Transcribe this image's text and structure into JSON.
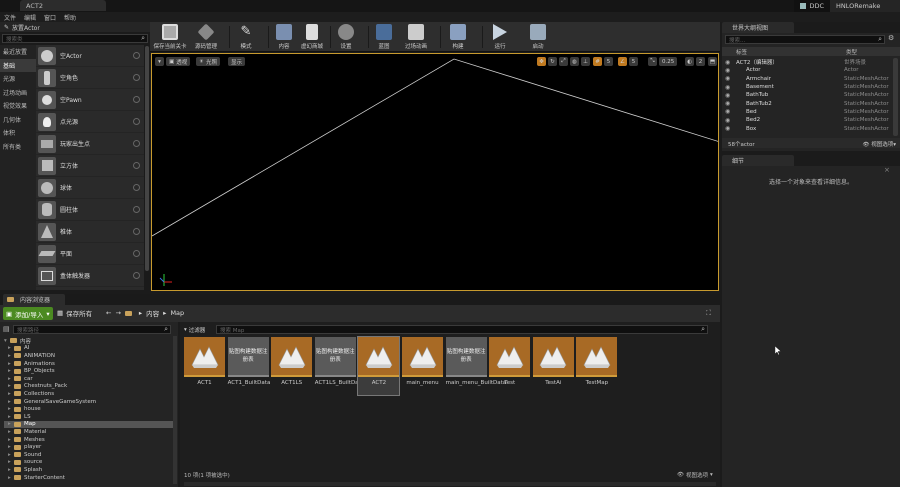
{
  "window": {
    "tab_title": "ACT2",
    "right_label": "DDC",
    "project_name": "HNLORemake"
  },
  "menu": [
    "文件",
    "编辑",
    "窗口",
    "帮助"
  ],
  "toolbar": [
    {
      "label": "保存当前关卡",
      "icon": "save-icon"
    },
    {
      "label": "源码管理",
      "icon": "source-control-icon"
    },
    {
      "label": "模式",
      "icon": "modes-icon"
    },
    {
      "label": "内容",
      "icon": "content-icon"
    },
    {
      "label": "虚幻商城",
      "icon": "marketplace-icon"
    },
    {
      "label": "设置",
      "icon": "settings-icon"
    },
    {
      "label": "蓝图",
      "icon": "blueprints-icon"
    },
    {
      "label": "过场动画",
      "icon": "cinematics-icon"
    },
    {
      "label": "构建",
      "icon": "build-icon"
    },
    {
      "label": "运行",
      "icon": "play-icon"
    },
    {
      "label": "启动",
      "icon": "launch-icon"
    }
  ],
  "modes": {
    "tab_label": "放置Actor",
    "search_placeholder": "搜索类",
    "categories": [
      "最近放置",
      "基础",
      "光源",
      "过场动画",
      "视觉效果",
      "几何体",
      "体积",
      "所有类"
    ],
    "active_category": 1,
    "items": [
      "空Actor",
      "空角色",
      "空Pawn",
      "点光源",
      "玩家出生点",
      "立方体",
      "球体",
      "圆柱体",
      "椎体",
      "平面",
      "盒体触发器"
    ]
  },
  "viewport": {
    "perspective_label": "透视",
    "lit_label": "光照",
    "show_label": "显示",
    "grid_snap": "5",
    "rot_snap": "5",
    "scale_snap": "0.25",
    "camera_speed": "2"
  },
  "outliner": {
    "tab_label": "世界大纲视图",
    "search_placeholder": "搜索...",
    "col_label": "标签",
    "col_type": "类型",
    "rows": [
      {
        "name": "ACT2（编辑器）",
        "type": "世界场景",
        "indent": 0
      },
      {
        "name": "Actor",
        "type": "Actor",
        "indent": 1
      },
      {
        "name": "Armchair",
        "type": "StaticMeshActor",
        "indent": 1
      },
      {
        "name": "Basement",
        "type": "StaticMeshActor",
        "indent": 1
      },
      {
        "name": "BathTub",
        "type": "StaticMeshActor",
        "indent": 1
      },
      {
        "name": "BathTub2",
        "type": "StaticMeshActor",
        "indent": 1
      },
      {
        "name": "Bed",
        "type": "StaticMeshActor",
        "indent": 1
      },
      {
        "name": "Bed2",
        "type": "StaticMeshActor",
        "indent": 1
      },
      {
        "name": "Box",
        "type": "StaticMeshActor",
        "indent": 1
      }
    ],
    "count_label": "58个actor",
    "view_options": "视图选项"
  },
  "details": {
    "tab_label": "细节",
    "empty_text": "选择一个对象来查看详细信息。"
  },
  "content_browser": {
    "tab_label": "内容浏览器",
    "add_label": "添加/导入",
    "save_all_label": "保存所有",
    "path_root": "内容",
    "path_current": "Map",
    "folder_search_placeholder": "搜索路径",
    "filters_label": "过滤器",
    "asset_search_placeholder": "搜索 Map",
    "folders": [
      {
        "name": "内容",
        "depth": 0,
        "selected": false
      },
      {
        "name": "AI",
        "depth": 1,
        "selected": false
      },
      {
        "name": "ANIMATION",
        "depth": 1,
        "selected": false
      },
      {
        "name": "Animations",
        "depth": 1,
        "selected": false
      },
      {
        "name": "BP_Objects",
        "depth": 1,
        "selected": false
      },
      {
        "name": "car",
        "depth": 1,
        "selected": false
      },
      {
        "name": "Chestnuts_Pack",
        "depth": 1,
        "selected": false
      },
      {
        "name": "Collections",
        "depth": 1,
        "selected": false
      },
      {
        "name": "GeneralSaveGameSystem",
        "depth": 1,
        "selected": false
      },
      {
        "name": "house",
        "depth": 1,
        "selected": false
      },
      {
        "name": "LS",
        "depth": 1,
        "selected": false
      },
      {
        "name": "Map",
        "depth": 1,
        "selected": true
      },
      {
        "name": "Material",
        "depth": 1,
        "selected": false
      },
      {
        "name": "Meshes",
        "depth": 1,
        "selected": false
      },
      {
        "name": "player",
        "depth": 1,
        "selected": false
      },
      {
        "name": "Sound",
        "depth": 1,
        "selected": false
      },
      {
        "name": "source",
        "depth": 1,
        "selected": false
      },
      {
        "name": "Splash",
        "depth": 1,
        "selected": false
      },
      {
        "name": "StarterContent",
        "depth": 1,
        "selected": false
      }
    ],
    "assets": [
      {
        "name": "ACT1",
        "kind": "map",
        "thumb_text": "",
        "selected": false
      },
      {
        "name": "ACT1_BuiltData",
        "kind": "builtdata",
        "thumb_text": "贴图构建数据注册表",
        "selected": false
      },
      {
        "name": "ACT1LS",
        "kind": "map",
        "thumb_text": "",
        "selected": false
      },
      {
        "name": "ACT1LS_BuiltData",
        "kind": "builtdata",
        "thumb_text": "贴图构建数据注册表",
        "selected": false
      },
      {
        "name": "ACT2",
        "kind": "map",
        "thumb_text": "",
        "selected": true
      },
      {
        "name": "main_menu",
        "kind": "map",
        "thumb_text": "",
        "selected": false
      },
      {
        "name": "main_menu_BuiltData",
        "kind": "builtdata",
        "thumb_text": "贴图构建数据注册表",
        "selected": false
      },
      {
        "name": "Test",
        "kind": "map",
        "thumb_text": "",
        "selected": false
      },
      {
        "name": "TestAi",
        "kind": "map",
        "thumb_text": "",
        "selected": false
      },
      {
        "name": "TestMap",
        "kind": "map",
        "thumb_text": "",
        "selected": false
      }
    ],
    "status": "10 项(1 项被选中)",
    "view_options": "视图选项"
  },
  "colors": {
    "accent_orange": "#c79a2e",
    "add_green": "#4b8a21",
    "map_thumb": "#a86a25"
  }
}
